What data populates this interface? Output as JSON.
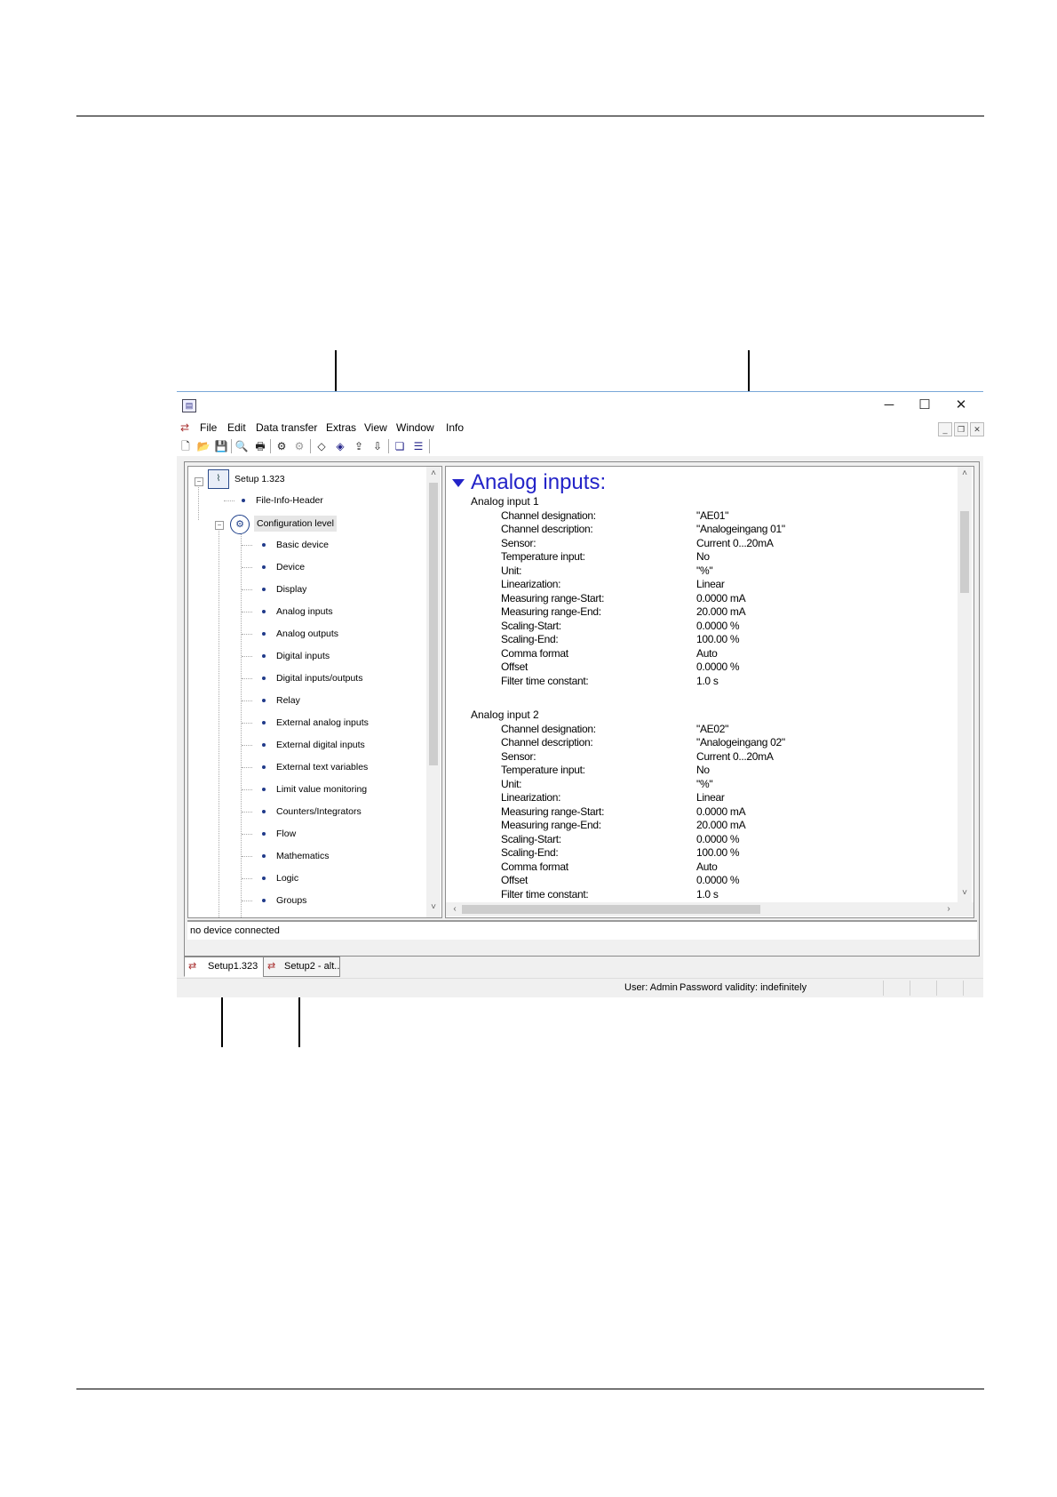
{
  "window": {
    "menu": [
      "File",
      "Edit",
      "Data transfer",
      "Extras",
      "View",
      "Window",
      "Info"
    ]
  },
  "tree": {
    "root": "Setup 1.323",
    "file_header": "File-Info-Header",
    "config_level": "Configuration level",
    "items": [
      "Basic device",
      "Device",
      "Display",
      "Analog inputs",
      "Analog outputs",
      "Digital inputs",
      "Digital inputs/outputs",
      "Relay",
      "External analog inputs",
      "External digital inputs",
      "External text variables",
      "Limit value monitoring",
      "Counters/Integrators",
      "Flow",
      "Mathematics",
      "Logic",
      "Groups"
    ]
  },
  "detail": {
    "heading": "Analog inputs:",
    "groups": [
      {
        "title": "Analog input 1",
        "rows": [
          [
            "Channel designation:",
            "\"AE01\""
          ],
          [
            "Channel description:",
            "\"Analogeingang 01\""
          ],
          [
            "Sensor:",
            "Current 0...20mA"
          ],
          [
            "Temperature input:",
            "No"
          ],
          [
            "Unit:",
            "\"%\""
          ],
          [
            "Linearization:",
            "Linear"
          ],
          [
            "Measuring range-Start:",
            "0.0000 mA"
          ],
          [
            "Measuring range-End:",
            "20.000 mA"
          ],
          [
            "Scaling-Start:",
            "0.0000 %"
          ],
          [
            "Scaling-End:",
            "100.00 %"
          ],
          [
            "Comma format",
            "Auto"
          ],
          [
            "Offset",
            "0.0000 %"
          ],
          [
            "Filter time constant:",
            "1.0 s"
          ]
        ]
      },
      {
        "title": "Analog input 2",
        "rows": [
          [
            "Channel designation:",
            "\"AE02\""
          ],
          [
            "Channel description:",
            "\"Analogeingang 02\""
          ],
          [
            "Sensor:",
            "Current 0...20mA"
          ],
          [
            "Temperature input:",
            "No"
          ],
          [
            "Unit:",
            "\"%\""
          ],
          [
            "Linearization:",
            "Linear"
          ],
          [
            "Measuring range-Start:",
            "0.0000 mA"
          ],
          [
            "Measuring range-End:",
            "20.000 mA"
          ],
          [
            "Scaling-Start:",
            "0.0000 %"
          ],
          [
            "Scaling-End:",
            "100.00 %"
          ],
          [
            "Comma format",
            "Auto"
          ],
          [
            "Offset",
            "0.0000 %"
          ],
          [
            "Filter time constant:",
            "1.0 s"
          ]
        ]
      }
    ]
  },
  "status": {
    "connection": "no device connected",
    "user": "User: Admin",
    "password": "Password validity: indefinitely"
  },
  "tabs": [
    "Setup1.323",
    "Setup2 - alt..."
  ]
}
